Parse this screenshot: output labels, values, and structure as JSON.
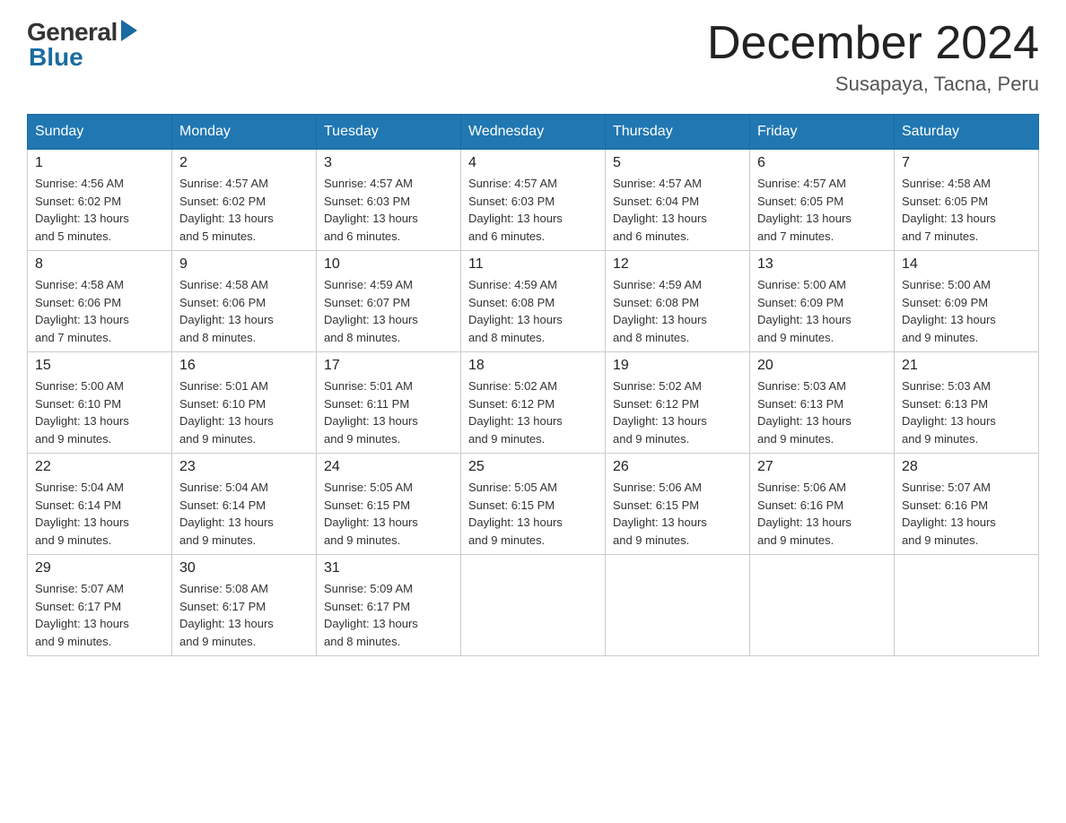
{
  "header": {
    "logo": {
      "general": "General",
      "blue": "Blue"
    },
    "title": "December 2024",
    "location": "Susapaya, Tacna, Peru"
  },
  "weekdays": [
    "Sunday",
    "Monday",
    "Tuesday",
    "Wednesday",
    "Thursday",
    "Friday",
    "Saturday"
  ],
  "weeks": [
    [
      {
        "day": "1",
        "sunrise": "4:56 AM",
        "sunset": "6:02 PM",
        "daylight": "13 hours and 5 minutes."
      },
      {
        "day": "2",
        "sunrise": "4:57 AM",
        "sunset": "6:02 PM",
        "daylight": "13 hours and 5 minutes."
      },
      {
        "day": "3",
        "sunrise": "4:57 AM",
        "sunset": "6:03 PM",
        "daylight": "13 hours and 6 minutes."
      },
      {
        "day": "4",
        "sunrise": "4:57 AM",
        "sunset": "6:03 PM",
        "daylight": "13 hours and 6 minutes."
      },
      {
        "day": "5",
        "sunrise": "4:57 AM",
        "sunset": "6:04 PM",
        "daylight": "13 hours and 6 minutes."
      },
      {
        "day": "6",
        "sunrise": "4:57 AM",
        "sunset": "6:05 PM",
        "daylight": "13 hours and 7 minutes."
      },
      {
        "day": "7",
        "sunrise": "4:58 AM",
        "sunset": "6:05 PM",
        "daylight": "13 hours and 7 minutes."
      }
    ],
    [
      {
        "day": "8",
        "sunrise": "4:58 AM",
        "sunset": "6:06 PM",
        "daylight": "13 hours and 7 minutes."
      },
      {
        "day": "9",
        "sunrise": "4:58 AM",
        "sunset": "6:06 PM",
        "daylight": "13 hours and 8 minutes."
      },
      {
        "day": "10",
        "sunrise": "4:59 AM",
        "sunset": "6:07 PM",
        "daylight": "13 hours and 8 minutes."
      },
      {
        "day": "11",
        "sunrise": "4:59 AM",
        "sunset": "6:08 PM",
        "daylight": "13 hours and 8 minutes."
      },
      {
        "day": "12",
        "sunrise": "4:59 AM",
        "sunset": "6:08 PM",
        "daylight": "13 hours and 8 minutes."
      },
      {
        "day": "13",
        "sunrise": "5:00 AM",
        "sunset": "6:09 PM",
        "daylight": "13 hours and 9 minutes."
      },
      {
        "day": "14",
        "sunrise": "5:00 AM",
        "sunset": "6:09 PM",
        "daylight": "13 hours and 9 minutes."
      }
    ],
    [
      {
        "day": "15",
        "sunrise": "5:00 AM",
        "sunset": "6:10 PM",
        "daylight": "13 hours and 9 minutes."
      },
      {
        "day": "16",
        "sunrise": "5:01 AM",
        "sunset": "6:10 PM",
        "daylight": "13 hours and 9 minutes."
      },
      {
        "day": "17",
        "sunrise": "5:01 AM",
        "sunset": "6:11 PM",
        "daylight": "13 hours and 9 minutes."
      },
      {
        "day": "18",
        "sunrise": "5:02 AM",
        "sunset": "6:12 PM",
        "daylight": "13 hours and 9 minutes."
      },
      {
        "day": "19",
        "sunrise": "5:02 AM",
        "sunset": "6:12 PM",
        "daylight": "13 hours and 9 minutes."
      },
      {
        "day": "20",
        "sunrise": "5:03 AM",
        "sunset": "6:13 PM",
        "daylight": "13 hours and 9 minutes."
      },
      {
        "day": "21",
        "sunrise": "5:03 AM",
        "sunset": "6:13 PM",
        "daylight": "13 hours and 9 minutes."
      }
    ],
    [
      {
        "day": "22",
        "sunrise": "5:04 AM",
        "sunset": "6:14 PM",
        "daylight": "13 hours and 9 minutes."
      },
      {
        "day": "23",
        "sunrise": "5:04 AM",
        "sunset": "6:14 PM",
        "daylight": "13 hours and 9 minutes."
      },
      {
        "day": "24",
        "sunrise": "5:05 AM",
        "sunset": "6:15 PM",
        "daylight": "13 hours and 9 minutes."
      },
      {
        "day": "25",
        "sunrise": "5:05 AM",
        "sunset": "6:15 PM",
        "daylight": "13 hours and 9 minutes."
      },
      {
        "day": "26",
        "sunrise": "5:06 AM",
        "sunset": "6:15 PM",
        "daylight": "13 hours and 9 minutes."
      },
      {
        "day": "27",
        "sunrise": "5:06 AM",
        "sunset": "6:16 PM",
        "daylight": "13 hours and 9 minutes."
      },
      {
        "day": "28",
        "sunrise": "5:07 AM",
        "sunset": "6:16 PM",
        "daylight": "13 hours and 9 minutes."
      }
    ],
    [
      {
        "day": "29",
        "sunrise": "5:07 AM",
        "sunset": "6:17 PM",
        "daylight": "13 hours and 9 minutes."
      },
      {
        "day": "30",
        "sunrise": "5:08 AM",
        "sunset": "6:17 PM",
        "daylight": "13 hours and 9 minutes."
      },
      {
        "day": "31",
        "sunrise": "5:09 AM",
        "sunset": "6:17 PM",
        "daylight": "13 hours and 8 minutes."
      },
      null,
      null,
      null,
      null
    ]
  ]
}
